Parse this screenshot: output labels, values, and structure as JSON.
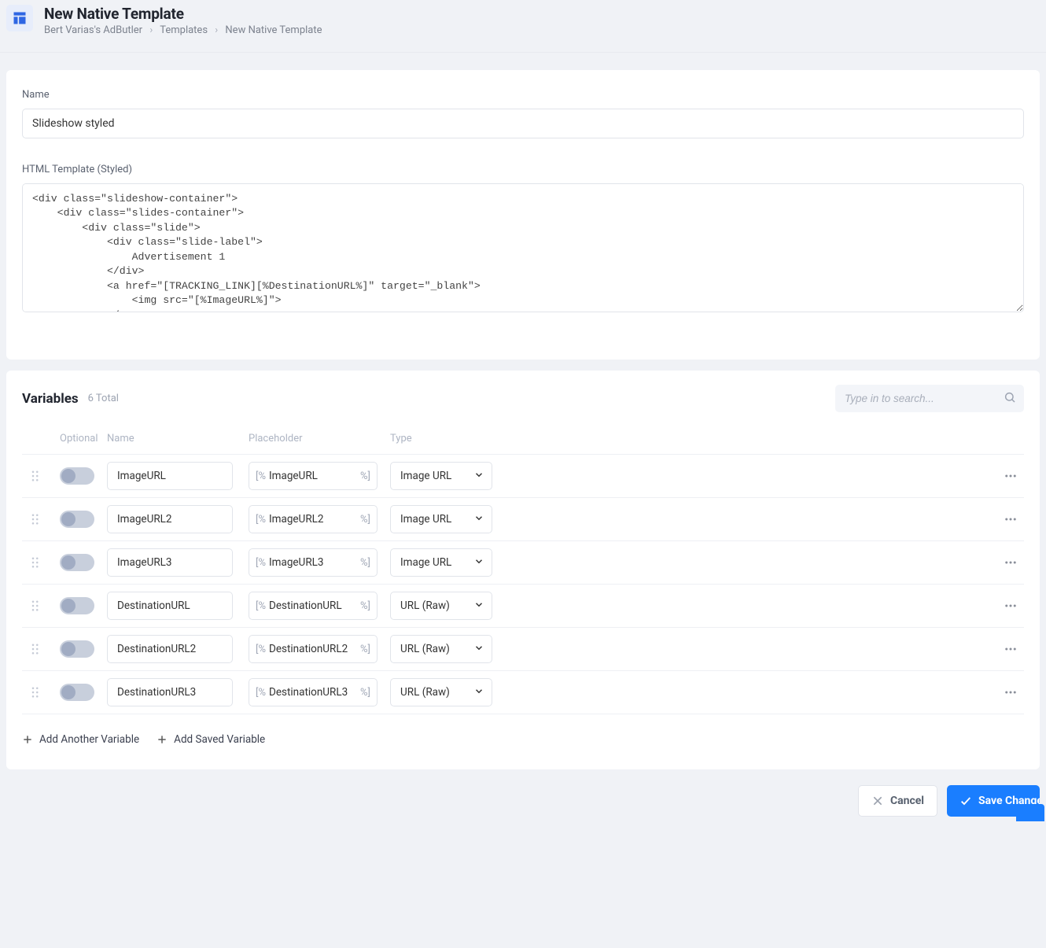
{
  "header": {
    "title": "New Native Template",
    "breadcrumb": [
      "Bert Varias's AdButler",
      "Templates",
      "New Native Template"
    ]
  },
  "form": {
    "name_label": "Name",
    "name_value": "Slideshow styled",
    "html_label": "HTML Template (Styled)",
    "html_value": "<div class=\"slideshow-container\">\n    <div class=\"slides-container\">\n        <div class=\"slide\">\n            <div class=\"slide-label\">\n                Advertisement 1\n            </div>\n            <a href=\"[TRACKING_LINK][%DestinationURL%]\" target=\"_blank\">\n                <img src=\"[%ImageURL%]\">\n            </a>\n        </div>\n        <div class=\"slide\">"
  },
  "variables": {
    "title": "Variables",
    "count_label": "6 Total",
    "search_placeholder": "Type in to search...",
    "columns": {
      "optional": "Optional",
      "name": "Name",
      "placeholder": "Placeholder",
      "type": "Type"
    },
    "placeholder_prefix": "[%",
    "placeholder_suffix": "%]",
    "rows": [
      {
        "optional": false,
        "name": "ImageURL",
        "placeholder": "ImageURL",
        "type": "Image URL"
      },
      {
        "optional": false,
        "name": "ImageURL2",
        "placeholder": "ImageURL2",
        "type": "Image URL"
      },
      {
        "optional": false,
        "name": "ImageURL3",
        "placeholder": "ImageURL3",
        "type": "Image URL"
      },
      {
        "optional": false,
        "name": "DestinationURL",
        "placeholder": "DestinationURL",
        "type": "URL (Raw)"
      },
      {
        "optional": false,
        "name": "DestinationURL2",
        "placeholder": "DestinationURL2",
        "type": "URL (Raw)"
      },
      {
        "optional": false,
        "name": "DestinationURL3",
        "placeholder": "DestinationURL3",
        "type": "URL (Raw)"
      }
    ],
    "type_options": [
      "Image URL",
      "URL (Raw)"
    ],
    "add_variable_label": "Add Another Variable",
    "add_saved_label": "Add Saved Variable"
  },
  "actions": {
    "cancel": "Cancel",
    "save": "Save Changes"
  }
}
